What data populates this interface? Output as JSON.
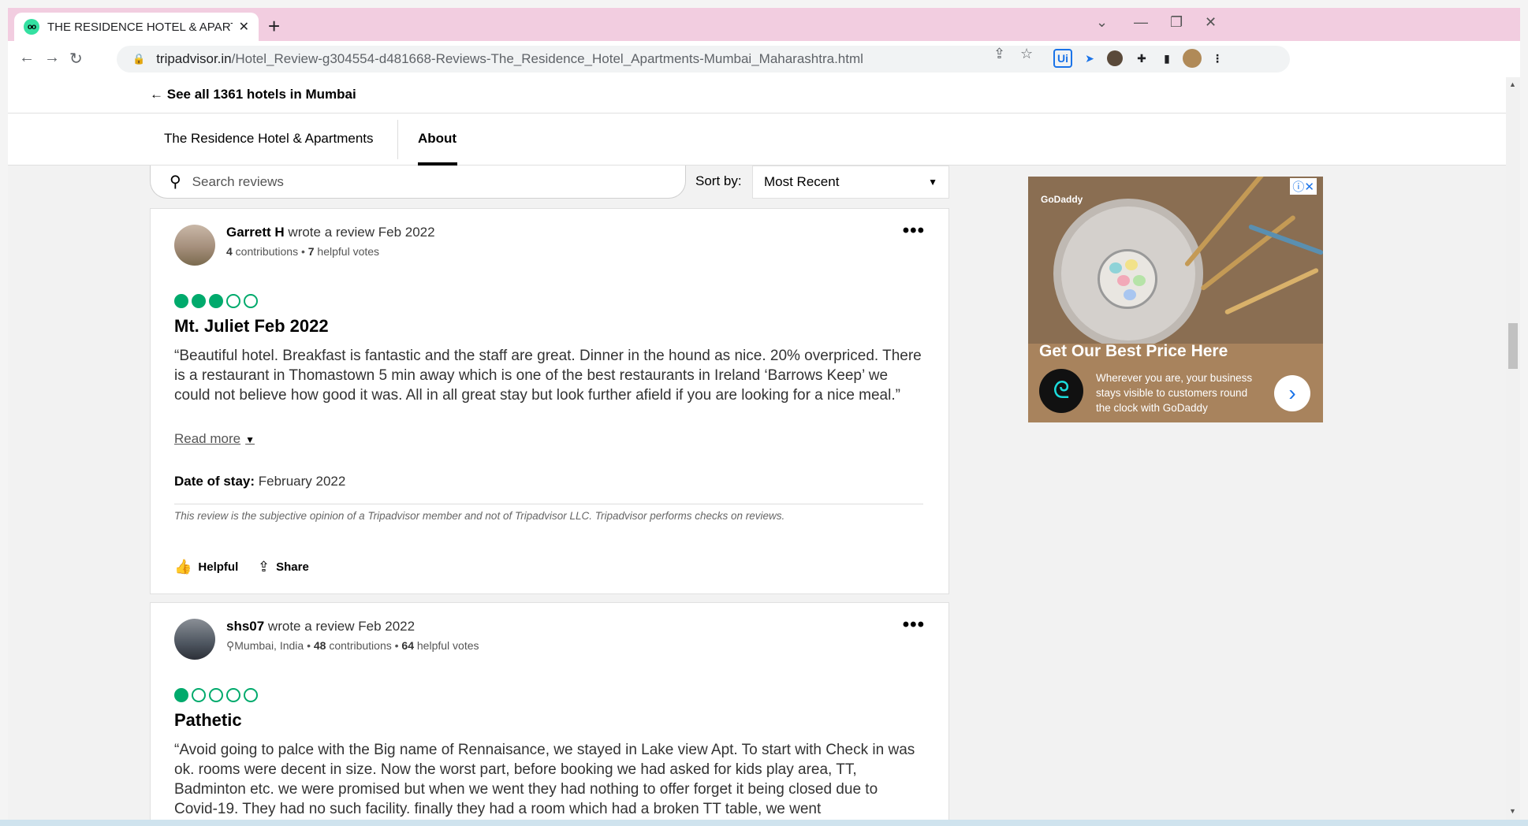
{
  "browser": {
    "tab_title": "THE RESIDENCE HOTEL & APART",
    "new_tab": "+",
    "url_domain": "tripadvisor.in",
    "url_path": "/Hotel_Review-g304554-d481668-Reviews-The_Residence_Hotel_Apartments-Mumbai_Maharashtra.html"
  },
  "page": {
    "back_link": "See all 1361 hotels in Mumbai",
    "hotel_name": "The Residence Hotel & Apartments",
    "about_tab": "About",
    "search_placeholder": "Search reviews",
    "sort_label": "Sort by:",
    "sort_value": "Most Recent"
  },
  "reviews": [
    {
      "user": "Garrett H",
      "action": " wrote a review Feb 2022",
      "contributions": "4",
      "contributions_label": " contributions • ",
      "helpful": "7",
      "helpful_label": " helpful votes",
      "rating": 3,
      "title": "Mt. Juliet Feb 2022",
      "body": "“Beautiful hotel. Breakfast is fantastic and the staff are great. Dinner in the hound as nice. 20% overpriced. There is a restaurant in Thomastown 5 min away which is one of the best restaurants in Ireland ‘Barrows Keep’ we could not believe how good it was. All in all great stay but look further afield if you are looking for a nice meal.”",
      "read_more": "Read more",
      "stay_label": "Date of stay:",
      "stay_value": " February 2022",
      "disclaimer": "This review is the subjective opinion of a Tripadvisor member and not of Tripadvisor LLC. Tripadvisor performs checks on reviews.",
      "helpful_btn": "Helpful",
      "share_btn": "Share"
    },
    {
      "user": "shs07",
      "action": " wrote a review Feb 2022",
      "location": "Mumbai, India • ",
      "contributions": "48",
      "contributions_label": " contributions • ",
      "helpful": "64",
      "helpful_label": " helpful votes",
      "rating": 1,
      "title": "Pathetic",
      "body": "“Avoid going to palce with the Big name of Rennaisance, we stayed in Lake view Apt. To start with Check in was ok. rooms were decent in size. Now the worst part, before booking we had asked for kids play area, TT, Badminton etc. we were promised but when we went they had nothing to offer forget it being closed due to Covid-19. They had no such facility. finally they had a room which had a broken TT table, we went"
    }
  ],
  "ad": {
    "brand": "GoDaddy",
    "headline": "Get Our Best Price Here",
    "text": "Wherever you are, your business stays visible to customers round the clock with GoDaddy",
    "cta": "›",
    "adchoices": "ⓘ✕"
  },
  "colors": {
    "rating_green": "#00aa6c",
    "tab_strip": "#f2cde0"
  }
}
